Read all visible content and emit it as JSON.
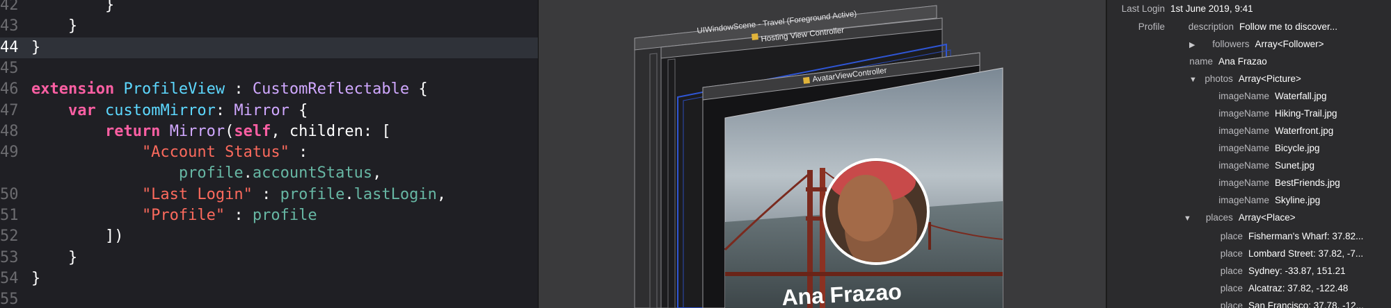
{
  "editor": {
    "lines": [
      {
        "num": "42",
        "tokens": [
          {
            "t": "plain",
            "v": "        }"
          }
        ]
      },
      {
        "num": "43",
        "tokens": [
          {
            "t": "plain",
            "v": "    }"
          }
        ]
      },
      {
        "num": "44",
        "tokens": [
          {
            "t": "plain",
            "v": "}"
          }
        ],
        "current": true
      },
      {
        "num": "45",
        "tokens": []
      },
      {
        "num": "46",
        "tokens": [
          {
            "t": "kw",
            "v": "extension "
          },
          {
            "t": "typ",
            "v": "ProfileView"
          },
          {
            "t": "plain",
            "v": " : "
          },
          {
            "t": "cls",
            "v": "CustomReflectable"
          },
          {
            "t": "plain",
            "v": " {"
          }
        ]
      },
      {
        "num": "47",
        "tokens": [
          {
            "t": "kw",
            "v": "    var "
          },
          {
            "t": "typ",
            "v": "customMirror"
          },
          {
            "t": "plain",
            "v": ": "
          },
          {
            "t": "cls",
            "v": "Mirror"
          },
          {
            "t": "plain",
            "v": " {"
          }
        ]
      },
      {
        "num": "48",
        "tokens": [
          {
            "t": "kw",
            "v": "        return "
          },
          {
            "t": "cls",
            "v": "Mirror"
          },
          {
            "t": "plain",
            "v": "("
          },
          {
            "t": "kw",
            "v": "self"
          },
          {
            "t": "plain",
            "v": ", children: ["
          }
        ]
      },
      {
        "num": "49",
        "tokens": [
          {
            "t": "str",
            "v": "            \"Account Status\""
          },
          {
            "t": "plain",
            "v": " :"
          }
        ]
      },
      {
        "num": "",
        "tokens": [
          {
            "t": "fn",
            "v": "                profile"
          },
          {
            "t": "plain",
            "v": "."
          },
          {
            "t": "fn",
            "v": "accountStatus"
          },
          {
            "t": "plain",
            "v": ","
          }
        ]
      },
      {
        "num": "50",
        "tokens": [
          {
            "t": "str",
            "v": "            \"Last Login\""
          },
          {
            "t": "plain",
            "v": " : "
          },
          {
            "t": "fn",
            "v": "profile"
          },
          {
            "t": "plain",
            "v": "."
          },
          {
            "t": "fn",
            "v": "lastLogin"
          },
          {
            "t": "plain",
            "v": ","
          }
        ]
      },
      {
        "num": "51",
        "tokens": [
          {
            "t": "str",
            "v": "            \"Profile\""
          },
          {
            "t": "plain",
            "v": " : "
          },
          {
            "t": "fn",
            "v": "profile"
          }
        ]
      },
      {
        "num": "52",
        "tokens": [
          {
            "t": "plain",
            "v": "        ])"
          }
        ]
      },
      {
        "num": "53",
        "tokens": [
          {
            "t": "plain",
            "v": "    }"
          }
        ]
      },
      {
        "num": "54",
        "tokens": [
          {
            "t": "plain",
            "v": "}"
          }
        ]
      },
      {
        "num": "55",
        "tokens": []
      }
    ]
  },
  "canvas": {
    "scene_label": "UIWindowScene - Travel (Foreground Active)",
    "hosting_label": "Hosting View Controller",
    "avatar_vc_label": "AvatarViewController",
    "profile_name": "Ana Frazao"
  },
  "inspector": {
    "rows": [
      {
        "key": "Last Login",
        "value": "1st June 2019, 9:41"
      },
      {
        "key": "Profile",
        "value": ""
      },
      {
        "key": "description",
        "value": "Follow me to discover..."
      },
      {
        "key": "followers",
        "value": "Array<Follower>",
        "disclosure": "collapsed"
      },
      {
        "key": "name",
        "value": "Ana Frazao"
      },
      {
        "key": "photos",
        "value": "Array<Picture>",
        "disclosure": "expanded"
      },
      {
        "key": "imageName",
        "value": "Waterfall.jpg"
      },
      {
        "key": "imageName",
        "value": "Hiking-Trail.jpg"
      },
      {
        "key": "imageName",
        "value": "Waterfront.jpg"
      },
      {
        "key": "imageName",
        "value": "Bicycle.jpg"
      },
      {
        "key": "imageName",
        "value": "Sunet.jpg"
      },
      {
        "key": "imageName",
        "value": "BestFriends.jpg"
      },
      {
        "key": "imageName",
        "value": "Skyline.jpg"
      },
      {
        "key": "places",
        "value": "Array<Place>",
        "disclosure": "expanded"
      },
      {
        "key": "place",
        "value": "Fisherman's Wharf: 37.82..."
      },
      {
        "key": "place",
        "value": "Lombard Street: 37.82, -7..."
      },
      {
        "key": "place",
        "value": "Sydney: -33.87, 151.21"
      },
      {
        "key": "place",
        "value": "Alcatraz: 37.82, -122.48"
      },
      {
        "key": "place",
        "value": "San Francisco: 37.78, -12..."
      }
    ]
  },
  "colors": {
    "keyword": "#fc5fa3",
    "type": "#5dd8ff",
    "class": "#d0a8ff",
    "function": "#67b7a4",
    "string": "#fc6a5d"
  }
}
